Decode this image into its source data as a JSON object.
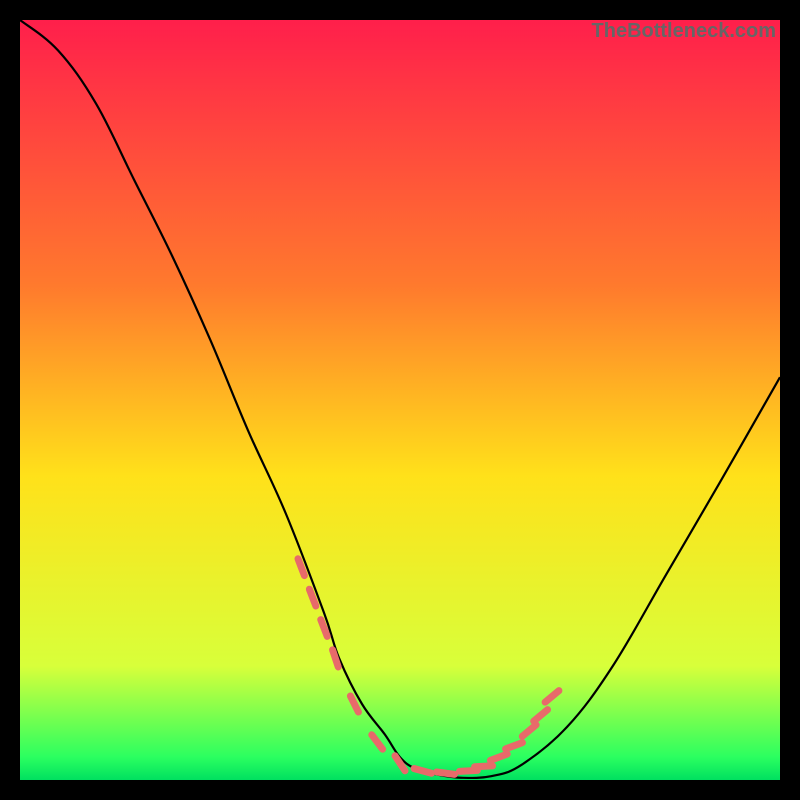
{
  "watermark": "TheBottleneck.com",
  "chart_data": {
    "type": "line",
    "title": "",
    "xlabel": "",
    "ylabel": "",
    "xlim": [
      0,
      100
    ],
    "ylim": [
      0,
      100
    ],
    "gradient_stops": [
      {
        "offset": 0,
        "color": "#ff1f4b"
      },
      {
        "offset": 35,
        "color": "#ff7a2d"
      },
      {
        "offset": 60,
        "color": "#ffe11a"
      },
      {
        "offset": 85,
        "color": "#d8ff3a"
      },
      {
        "offset": 97,
        "color": "#2bff60"
      },
      {
        "offset": 100,
        "color": "#00e060"
      }
    ],
    "series": [
      {
        "name": "bottleneck-curve",
        "x": [
          0,
          5,
          10,
          15,
          20,
          25,
          30,
          35,
          40,
          42,
          45,
          48,
          50,
          52,
          55,
          58,
          62,
          66,
          72,
          78,
          85,
          92,
          100
        ],
        "y": [
          100,
          96,
          89,
          79,
          69,
          58,
          46,
          35,
          22,
          16,
          10,
          6,
          3,
          1.5,
          0.7,
          0.3,
          0.5,
          2,
          7,
          15,
          27,
          39,
          53
        ]
      }
    ],
    "markers": {
      "name": "sample-points",
      "color": "#e86a6a",
      "x": [
        37,
        38.5,
        40,
        41.5,
        44,
        47,
        50,
        53,
        56,
        59,
        61,
        63,
        65,
        67,
        68.5,
        70
      ],
      "y": [
        28,
        24,
        20,
        16,
        10,
        5,
        2.2,
        1.2,
        0.9,
        1.2,
        1.8,
        3,
        4.5,
        6.5,
        8.5,
        11
      ]
    }
  }
}
